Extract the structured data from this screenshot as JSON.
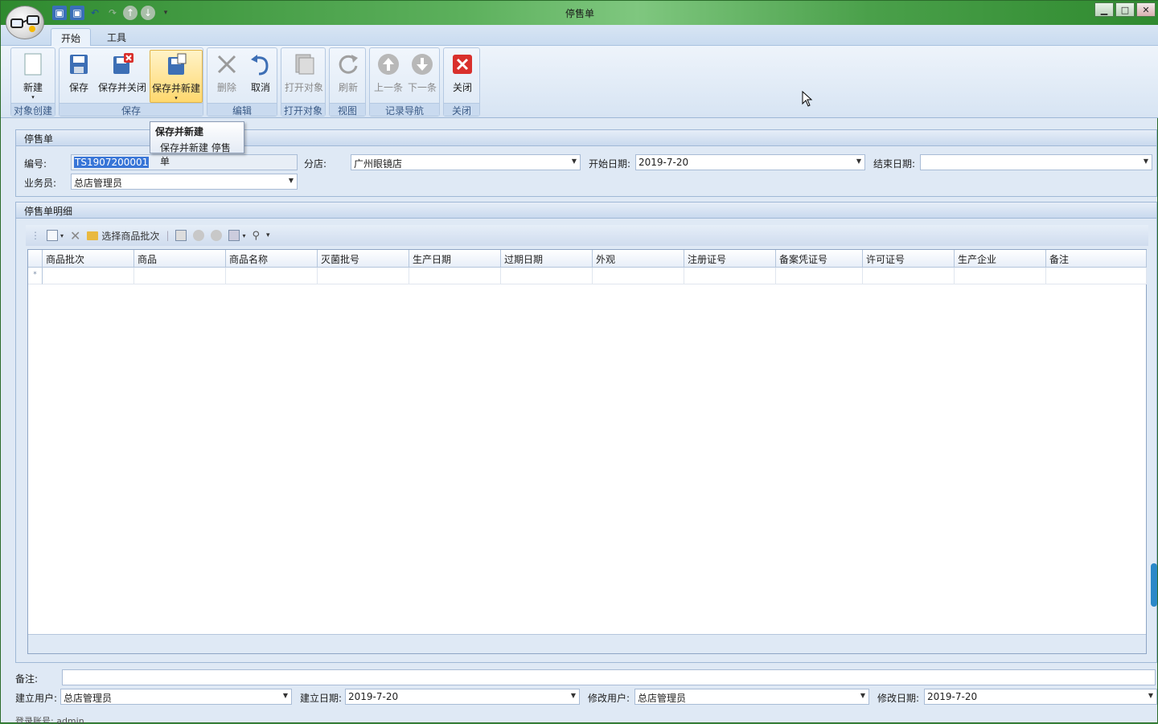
{
  "window": {
    "title": "停售单",
    "controls": {
      "minimize": "▁",
      "maximize": "□",
      "close": "✕"
    }
  },
  "tabs": [
    {
      "label": "开始",
      "active": true
    },
    {
      "label": "工具",
      "active": false
    }
  ],
  "ribbon": {
    "groups": [
      {
        "label": "对象创建",
        "buttons": [
          {
            "label": "新建",
            "icon": "new-doc-icon"
          }
        ]
      },
      {
        "label": "保存",
        "buttons": [
          {
            "label": "保存",
            "icon": "save-icon"
          },
          {
            "label": "保存并关闭",
            "icon": "save-close-icon"
          },
          {
            "label": "保存并新建",
            "icon": "save-new-icon",
            "hover": true
          }
        ]
      },
      {
        "label": "编辑",
        "buttons": [
          {
            "label": "删除",
            "icon": "delete-icon",
            "disabled": true
          },
          {
            "label": "取消",
            "icon": "undo-icon"
          }
        ]
      },
      {
        "label": "打开对象",
        "buttons": [
          {
            "label": "打开对象",
            "icon": "open-object-icon",
            "disabled": true
          }
        ]
      },
      {
        "label": "视图",
        "buttons": [
          {
            "label": "刷新",
            "icon": "refresh-icon",
            "disabled": true
          }
        ]
      },
      {
        "label": "记录导航",
        "buttons": [
          {
            "label": "上一条",
            "icon": "arrow-up-icon",
            "disabled": true
          },
          {
            "label": "下一条",
            "icon": "arrow-down-icon",
            "disabled": true
          }
        ]
      },
      {
        "label": "关闭",
        "buttons": [
          {
            "label": "关闭",
            "icon": "close-red-icon"
          }
        ]
      }
    ]
  },
  "tooltip": {
    "title": "保存并新建",
    "text": "保存并新建 停售单"
  },
  "header_panel": {
    "title": "停售单",
    "fields": {
      "code": {
        "label": "编号:",
        "value": "TS1907200001"
      },
      "branch": {
        "label": "分店:",
        "value": "广州眼镜店"
      },
      "start_date": {
        "label": "开始日期:",
        "value": "2019-7-20"
      },
      "end_date": {
        "label": "结束日期:",
        "value": ""
      },
      "salesman": {
        "label": "业务员:",
        "value": "总店管理员"
      }
    }
  },
  "detail_panel": {
    "title": "停售单明细",
    "toolbar": {
      "select_batch": "选择商品批次"
    },
    "columns": [
      "商品批次",
      "商品",
      "商品名称",
      "灭菌批号",
      "生产日期",
      "过期日期",
      "外观",
      "注册证号",
      "备案凭证号",
      "许可证号",
      "生产企业",
      "备注"
    ],
    "new_row_marker": "*"
  },
  "footer": {
    "remark": {
      "label": "备注:",
      "value": ""
    },
    "created_by": {
      "label": "建立用户:",
      "value": "总店管理员"
    },
    "created_date": {
      "label": "建立日期:",
      "value": "2019-7-20"
    },
    "modified_by": {
      "label": "修改用户:",
      "value": "总店管理员"
    },
    "modified_date": {
      "label": "修改日期:",
      "value": "2019-7-20"
    }
  },
  "status": {
    "text": "登录账号: admin"
  }
}
